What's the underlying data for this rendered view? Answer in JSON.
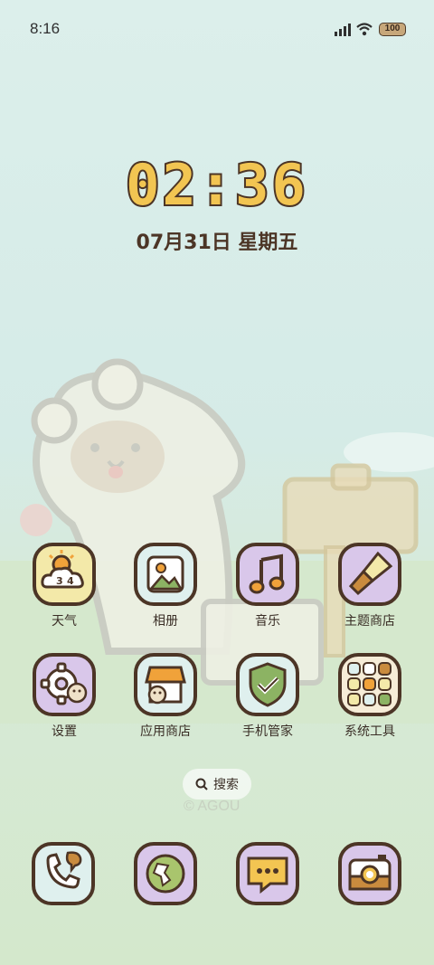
{
  "status_bar": {
    "time": "8:16",
    "battery": "100"
  },
  "clock": {
    "time": "02:36",
    "date": "07月31日 星期五"
  },
  "apps": [
    {
      "label": "天气",
      "icon": "weather-icon",
      "bg": "#f3e9a9"
    },
    {
      "label": "相册",
      "icon": "gallery-icon",
      "bg": "#dff0ee"
    },
    {
      "label": "音乐",
      "icon": "music-icon",
      "bg": "#d9c7ea"
    },
    {
      "label": "主题商店",
      "icon": "theme-brush-icon",
      "bg": "#d9c7ea"
    },
    {
      "label": "设置",
      "icon": "settings-gear-icon",
      "bg": "#d9c7ea"
    },
    {
      "label": "应用商店",
      "icon": "app-store-icon",
      "bg": "#dff0ee"
    },
    {
      "label": "手机管家",
      "icon": "shield-check-icon",
      "bg": "#dff0ee"
    },
    {
      "label": "系统工具",
      "icon": "tools-folder-icon",
      "bg": "#f6ecd7"
    }
  ],
  "search": {
    "label": "搜索"
  },
  "dock": [
    {
      "name": "phone-icon",
      "bg": "#dff0ee"
    },
    {
      "name": "browser-globe-icon",
      "bg": "#d9c7ea"
    },
    {
      "name": "messages-icon",
      "bg": "#d9c7ea"
    },
    {
      "name": "camera-icon",
      "bg": "#d9c7ea"
    }
  ],
  "watermark": "© AGOU",
  "colors": {
    "outline": "#4c3526",
    "clock_fill": "#f2c552",
    "accent_orange": "#f0a23a"
  }
}
